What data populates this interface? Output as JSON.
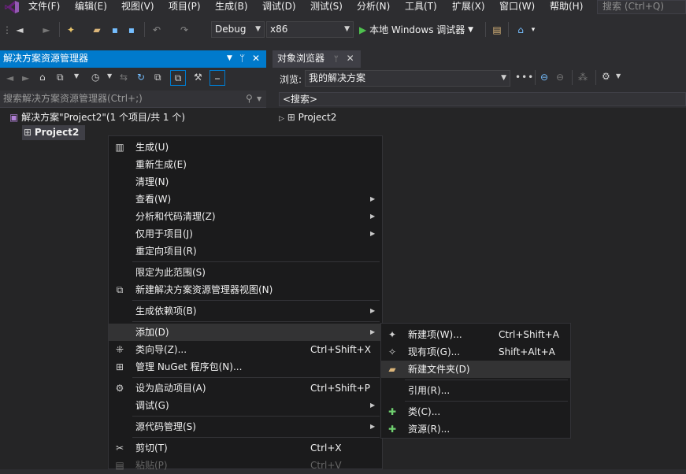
{
  "menubar": {
    "items": [
      "文件(F)",
      "编辑(E)",
      "视图(V)",
      "项目(P)",
      "生成(B)",
      "调试(D)",
      "测试(S)",
      "分析(N)",
      "工具(T)",
      "扩展(X)",
      "窗口(W)",
      "帮助(H)"
    ],
    "search_placeholder": "搜索 (Ctrl+Q)"
  },
  "toolbar": {
    "config": "Debug",
    "platform": "x86",
    "run_label": "本地 Windows 调试器"
  },
  "solution_explorer": {
    "title": "解决方案资源管理器",
    "search_placeholder": "搜索解决方案资源管理器(Ctrl+;)",
    "solution_label": "解决方案\"Project2\"(1 个项目/共 1 个)",
    "project_label": "Project2"
  },
  "object_browser": {
    "tab_title": "对象浏览器",
    "browse_label": "浏览:",
    "browse_value": "我的解决方案",
    "search_text": "<搜索>",
    "tree_item": "Project2"
  },
  "context_menu": {
    "items": [
      {
        "label": "生成(U)",
        "icon": "build-icon"
      },
      {
        "label": "重新生成(E)"
      },
      {
        "label": "清理(N)"
      },
      {
        "label": "查看(W)",
        "submenu": true
      },
      {
        "label": "分析和代码清理(Z)",
        "submenu": true
      },
      {
        "label": "仅用于项目(J)",
        "submenu": true
      },
      {
        "label": "重定向项目(R)"
      },
      {
        "label": "限定为此范围(S)"
      },
      {
        "label": "新建解决方案资源管理器视图(N)",
        "icon": "new-view-icon"
      },
      {
        "label": "生成依赖项(B)",
        "submenu": true
      },
      {
        "label": "添加(D)",
        "submenu": true,
        "highlighted": true
      },
      {
        "label": "类向导(Z)...",
        "shortcut": "Ctrl+Shift+X",
        "icon": "class-wizard-icon"
      },
      {
        "label": "管理 NuGet 程序包(N)...",
        "icon": "nuget-icon"
      },
      {
        "label": "设为启动项目(A)",
        "shortcut": "Ctrl+Shift+P",
        "icon": "gear-icon"
      },
      {
        "label": "调试(G)",
        "submenu": true
      },
      {
        "label": "源代码管理(S)",
        "submenu": true
      },
      {
        "label": "剪切(T)",
        "shortcut": "Ctrl+X",
        "icon": "scissors-icon"
      },
      {
        "label": "粘贴(P)",
        "shortcut": "Ctrl+V",
        "disabled": true,
        "icon": "paste-icon"
      }
    ]
  },
  "add_submenu": {
    "items": [
      {
        "label": "新建项(W)...",
        "shortcut": "Ctrl+Shift+A",
        "icon": "new-item-icon"
      },
      {
        "label": "现有项(G)...",
        "shortcut": "Shift+Alt+A",
        "icon": "existing-item-icon"
      },
      {
        "label": "新建文件夹(D)",
        "icon": "new-folder-icon",
        "highlighted": true
      },
      {
        "label": "引用(R)..."
      },
      {
        "label": "类(C)...",
        "icon": "class-icon"
      },
      {
        "label": "资源(R)...",
        "icon": "resource-icon"
      }
    ]
  },
  "colors": {
    "accent": "#007acc",
    "background": "#2d2d30",
    "menu_background": "#1b1b1c",
    "highlight": "#333334"
  }
}
